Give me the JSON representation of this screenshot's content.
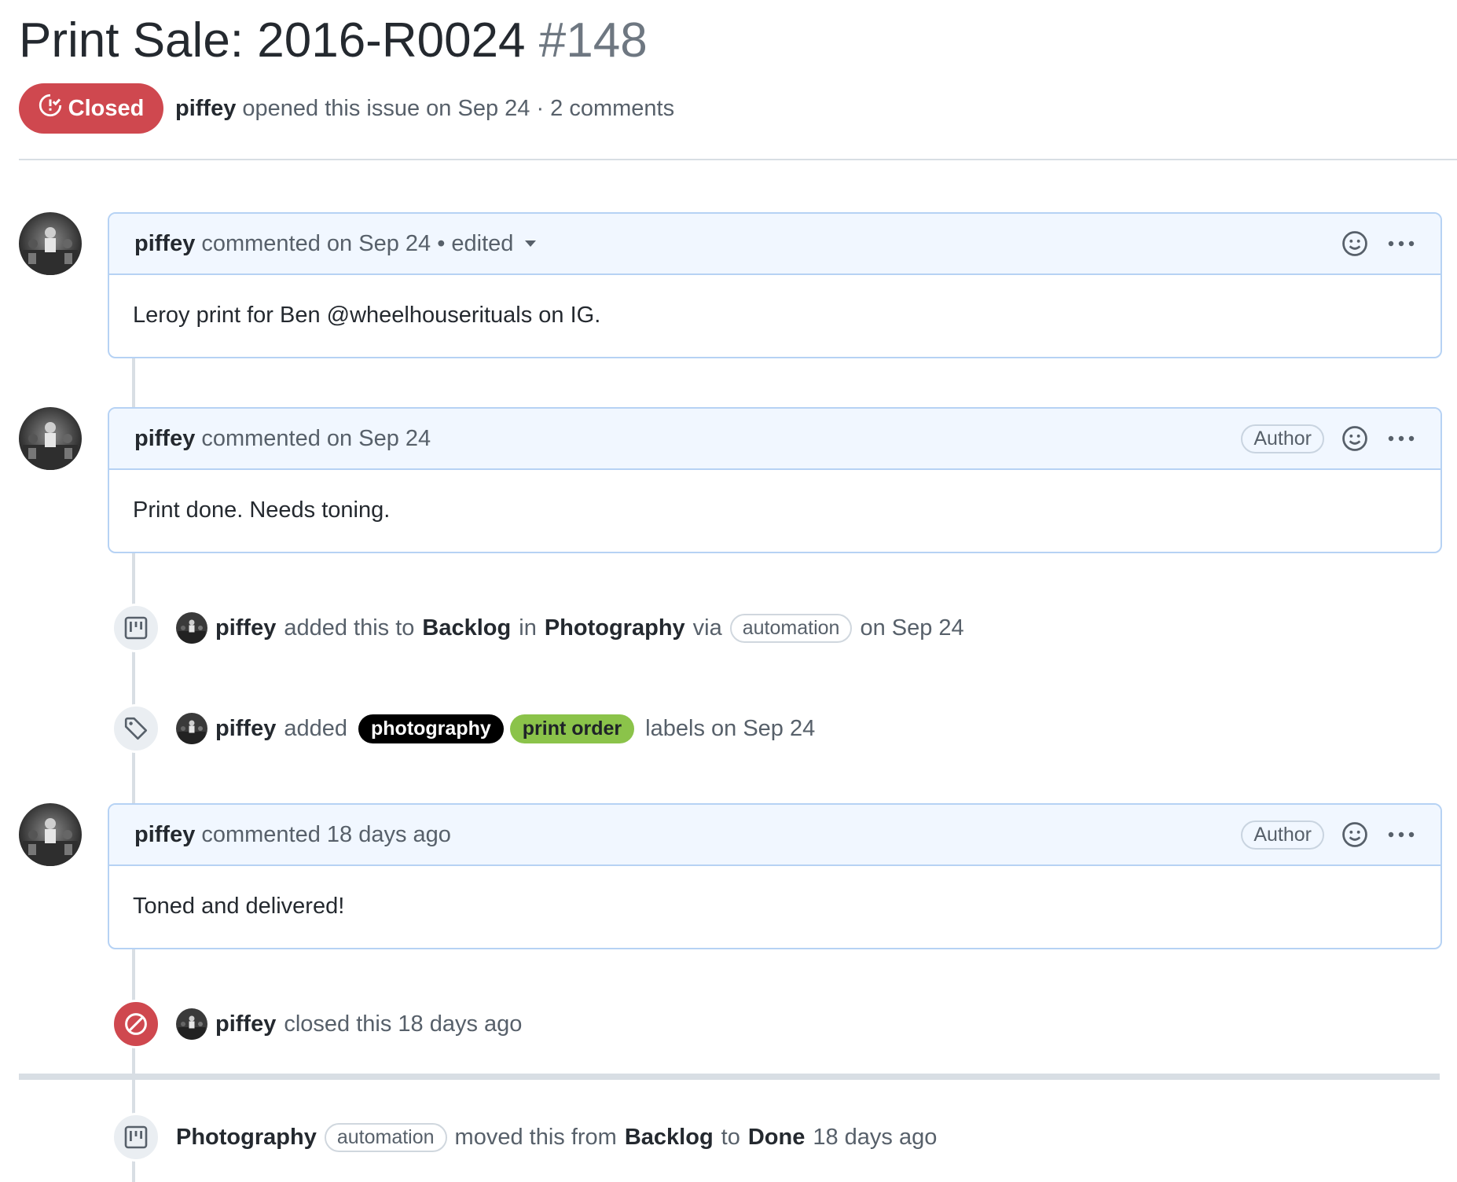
{
  "issue": {
    "title": "Print Sale: 2016-R0024",
    "number": "#148",
    "state": "Closed",
    "author": "piffey",
    "meta_text": "opened this issue on Sep 24 · 2 comments"
  },
  "comments": [
    {
      "author": "piffey",
      "header_text": "commented on Sep 24 • edited",
      "badge": "",
      "body": "Leroy print for Ben @wheelhouserituals on IG."
    },
    {
      "author": "piffey",
      "header_text": "commented on Sep 24",
      "badge": "Author",
      "body": "Print done. Needs toning."
    },
    {
      "author": "piffey",
      "header_text": "commented 18 days ago",
      "badge": "Author",
      "body": "Toned and delivered!"
    }
  ],
  "events": {
    "project_added": {
      "actor": "piffey",
      "t1": "added this to",
      "column": "Backlog",
      "t2": "in",
      "project": "Photography",
      "t3": "via",
      "via": "automation",
      "t4": "on Sep 24"
    },
    "labels_added": {
      "actor": "piffey",
      "t1": "added",
      "labels": [
        {
          "name": "photography",
          "bg": "#000000",
          "fg": "#ffffff"
        },
        {
          "name": "print order",
          "bg": "#8bc34a",
          "fg": "#1f2328"
        }
      ],
      "t2": "labels on Sep 24"
    },
    "closed": {
      "actor": "piffey",
      "t1": "closed this 18 days ago"
    },
    "moved": {
      "project": "Photography",
      "via": "automation",
      "t1": "moved this from",
      "from": "Backlog",
      "t2": "to",
      "to": "Done",
      "t3": "18 days ago"
    }
  },
  "colors": {
    "closed_red": "#cf484f",
    "comment_header_bg": "#f1f7ff",
    "comment_border": "#b6d2f4"
  },
  "icons": {
    "state": "issue-closed-icon",
    "reaction": "smiley-icon",
    "more": "kebab-horizontal-icon",
    "project": "project-icon",
    "label": "tag-icon",
    "closed_event": "circle-slash-icon",
    "edited_dropdown": "triangle-down-icon"
  }
}
